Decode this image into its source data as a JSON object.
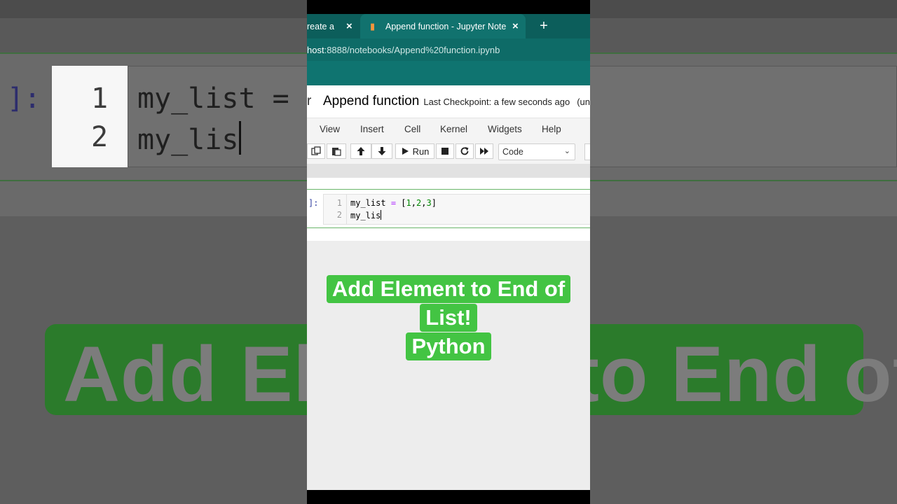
{
  "background_echo": {
    "prompt": "]:",
    "line_numbers": [
      "1",
      "2"
    ],
    "code_lines": [
      "my_list =",
      "my_lis"
    ],
    "caption": "Add Element to End of"
  },
  "browser": {
    "inactive_tab_title": "reate a n",
    "active_tab_title": "Append function - Jupyter Notebook",
    "new_tab_glyph": "+",
    "close_glyph": "×",
    "url_host": "host",
    "url_rest": ":8888/notebooks/Append%20function.ipynb"
  },
  "notebook": {
    "logo_fragment": "r",
    "title": "Append function",
    "checkpoint": "Last Checkpoint: a few seconds ago",
    "status": "(un"
  },
  "menu": [
    "View",
    "Insert",
    "Cell",
    "Kernel",
    "Widgets",
    "Help"
  ],
  "toolbar": {
    "run_label": "Run",
    "cell_type": "Code"
  },
  "cell": {
    "prompt": "]:",
    "line_numbers": [
      "1",
      "2"
    ],
    "line1": {
      "var": "my_list",
      "op": "=",
      "open": "[",
      "n1": "1",
      "n2": "2",
      "n3": "3",
      "close": "]"
    },
    "line2": "my_lis"
  },
  "caption": {
    "line1": "Add Element to End of",
    "line2": "List!",
    "line3": "Python",
    "color": "#43c443"
  }
}
